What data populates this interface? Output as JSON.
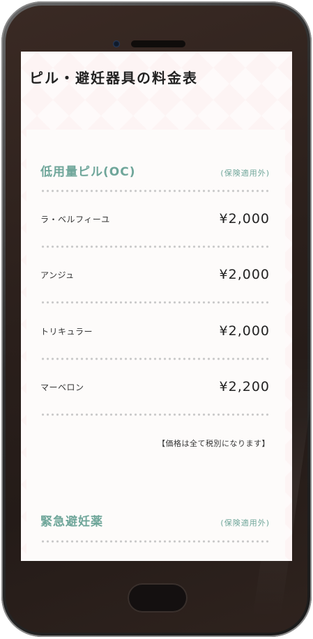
{
  "page": {
    "title": "ピル・避妊器具の料金表"
  },
  "sections": [
    {
      "title": "低用量ピル(OC)",
      "note": "(保険適用外)",
      "items": [
        {
          "name": "ラ・ベルフィーユ",
          "price": "¥2,000"
        },
        {
          "name": "アンジュ",
          "price": "¥2,000"
        },
        {
          "name": "トリキュラー",
          "price": "¥2,000"
        },
        {
          "name": "マーベロン",
          "price": "¥2,200"
        }
      ],
      "footnote": "【価格は全て税別になります】"
    },
    {
      "title": "緊急避妊薬",
      "note": "(保険適用外)"
    }
  ]
}
